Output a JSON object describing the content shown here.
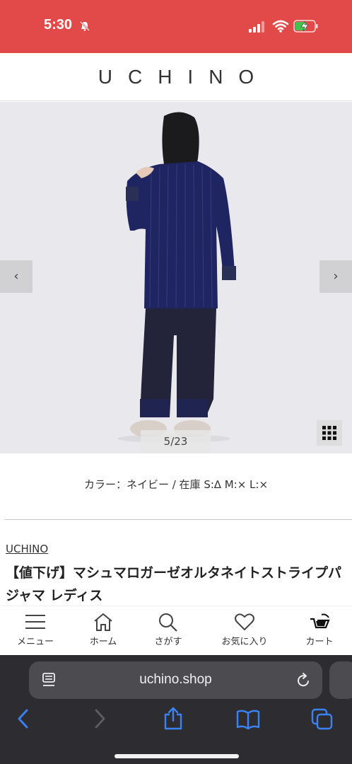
{
  "status_bar": {
    "time": "5:30",
    "background": "#e24a4a"
  },
  "header": {
    "logo": "UCHINO"
  },
  "gallery": {
    "prev_label": "‹",
    "next_label": "›",
    "counter": "5/23"
  },
  "product": {
    "color_stock": "カラー：ネイビー / 在庫 S:∆  M:×  L:×",
    "brand": "UCHINO",
    "title": "【値下げ】マシュマロガーゼオルタネイトストライプパジャマ レディス"
  },
  "bottom_nav": {
    "items": [
      {
        "label": "メニュー",
        "icon": "menu-icon"
      },
      {
        "label": "ホーム",
        "icon": "home-icon"
      },
      {
        "label": "さがす",
        "icon": "search-icon"
      },
      {
        "label": "お気に入り",
        "icon": "heart-icon"
      },
      {
        "label": "カート",
        "icon": "cart-icon"
      }
    ]
  },
  "browser": {
    "url": "uchino.shop"
  },
  "colors": {
    "accent": "#e24a4a",
    "garment": "#1e2560",
    "pants": "#23243a",
    "safari_bg": "#2d2d31"
  }
}
